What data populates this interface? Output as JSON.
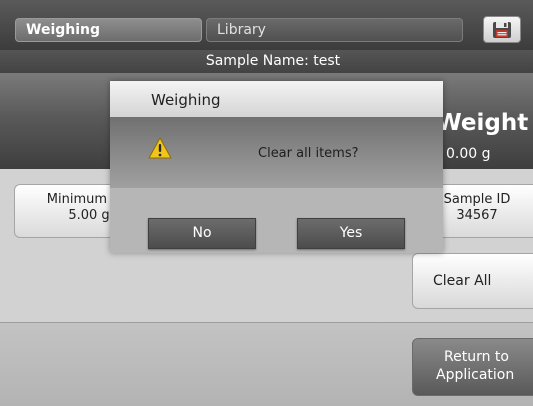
{
  "tabs": {
    "active_label": "Weighing",
    "inactive_label": "Library"
  },
  "toolbar": {
    "save_icon": "floppy-disk-icon"
  },
  "sample_bar": {
    "text": "Sample Name: test"
  },
  "main": {
    "title_fragment": "n Weight",
    "value_fragment": "0.00 g"
  },
  "info": {
    "min_weight_label": "Minimum We",
    "min_weight_value": "5.00 g",
    "sample_id_label": "Sample ID",
    "sample_id_value": "34567"
  },
  "actions": {
    "clear_all_label": "Clear All",
    "return_line1": "Return to",
    "return_line2": "Application"
  },
  "dialog": {
    "title": "Weighing",
    "message": "Clear all items?",
    "icon": "warning-icon",
    "no_label": "No",
    "yes_label": "Yes"
  },
  "colors": {
    "warning_yellow": "#f2c51c",
    "dialog_button": "#5a5a5a",
    "header_dark": "#4a4a4a"
  }
}
